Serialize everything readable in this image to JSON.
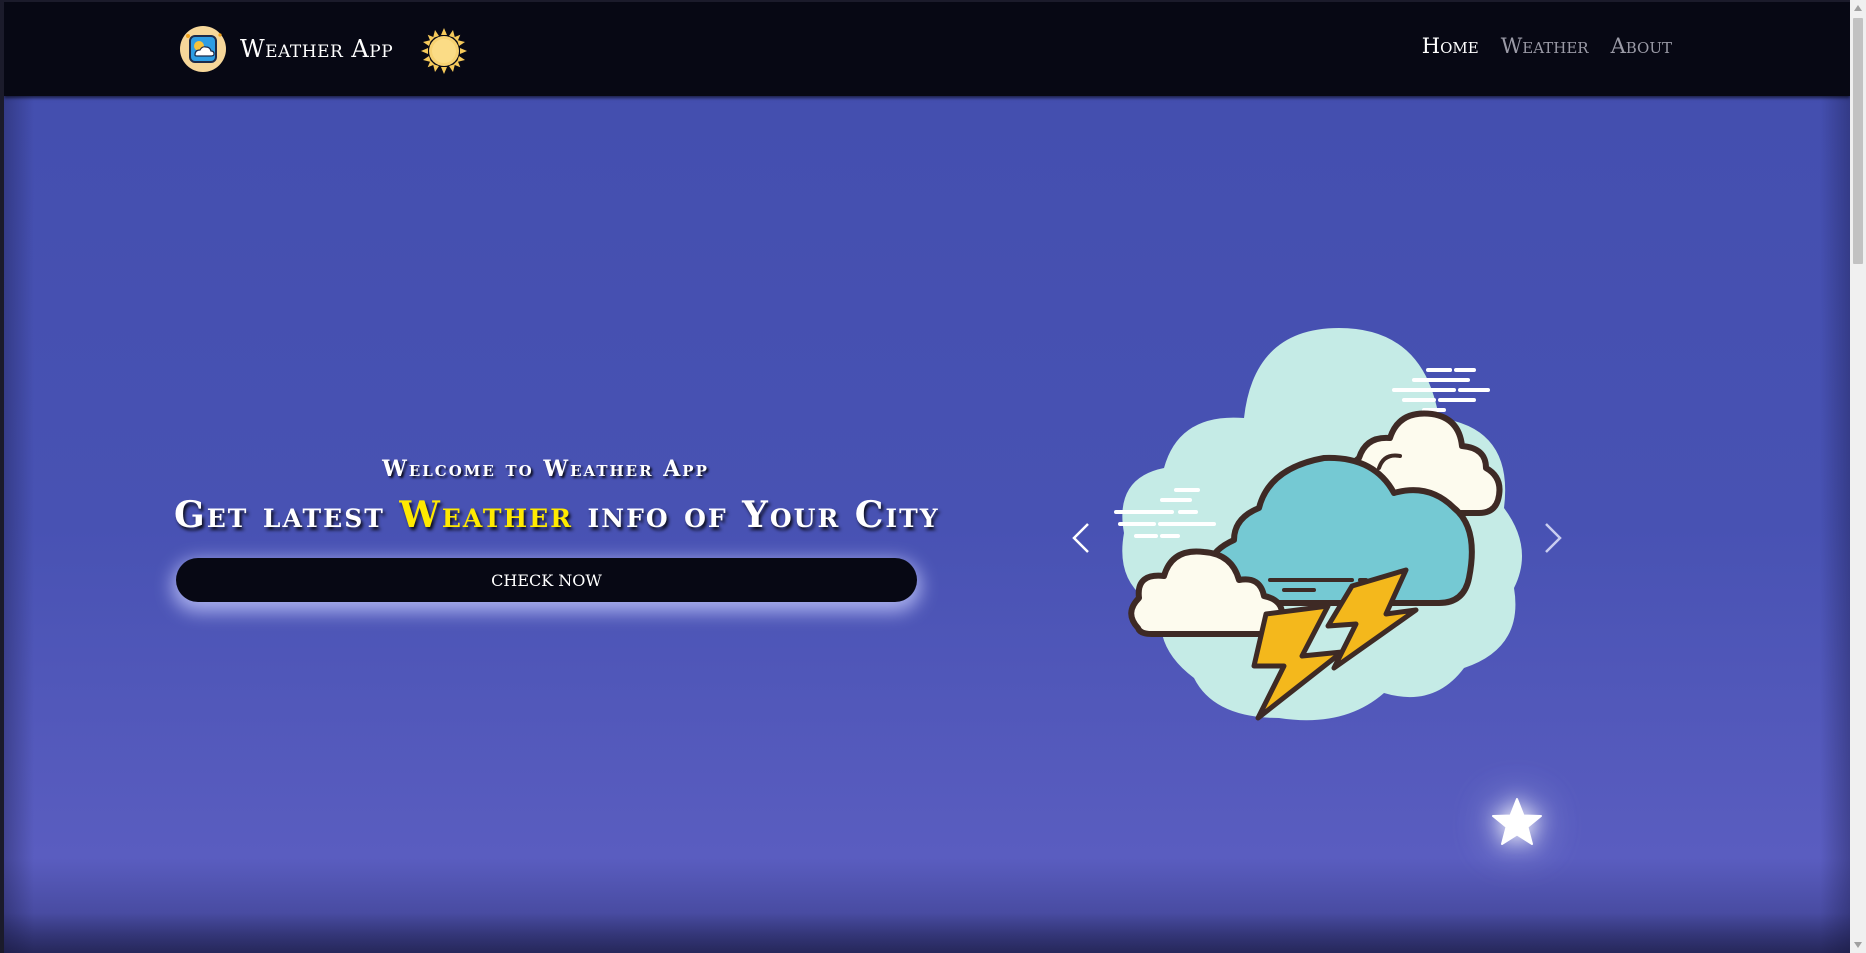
{
  "navbar": {
    "brand_name": "Weather App",
    "brand_logo_icon": "weather-app-logo-icon",
    "theme_icon": "sun-icon",
    "links": [
      {
        "label": "Home",
        "active": true
      },
      {
        "label": "Weather",
        "active": false
      },
      {
        "label": "About",
        "active": false
      }
    ]
  },
  "hero": {
    "subtitle": "Welcome to Weather App",
    "title_before": "Get latest ",
    "title_highlight": "Weather",
    "title_after": " info of Your City",
    "button_label": "CHECK NOW"
  },
  "carousel": {
    "illustration_icon": "thunderstorm-clouds-icon",
    "prev_icon": "chevron-left-icon",
    "next_icon": "chevron-right-icon"
  },
  "decor": {
    "star_icon": "star-icon"
  },
  "colors": {
    "navbar_bg": "#070814",
    "hero_bg": "#434eae",
    "highlight": "#ffea00",
    "button_bg": "#070814"
  }
}
